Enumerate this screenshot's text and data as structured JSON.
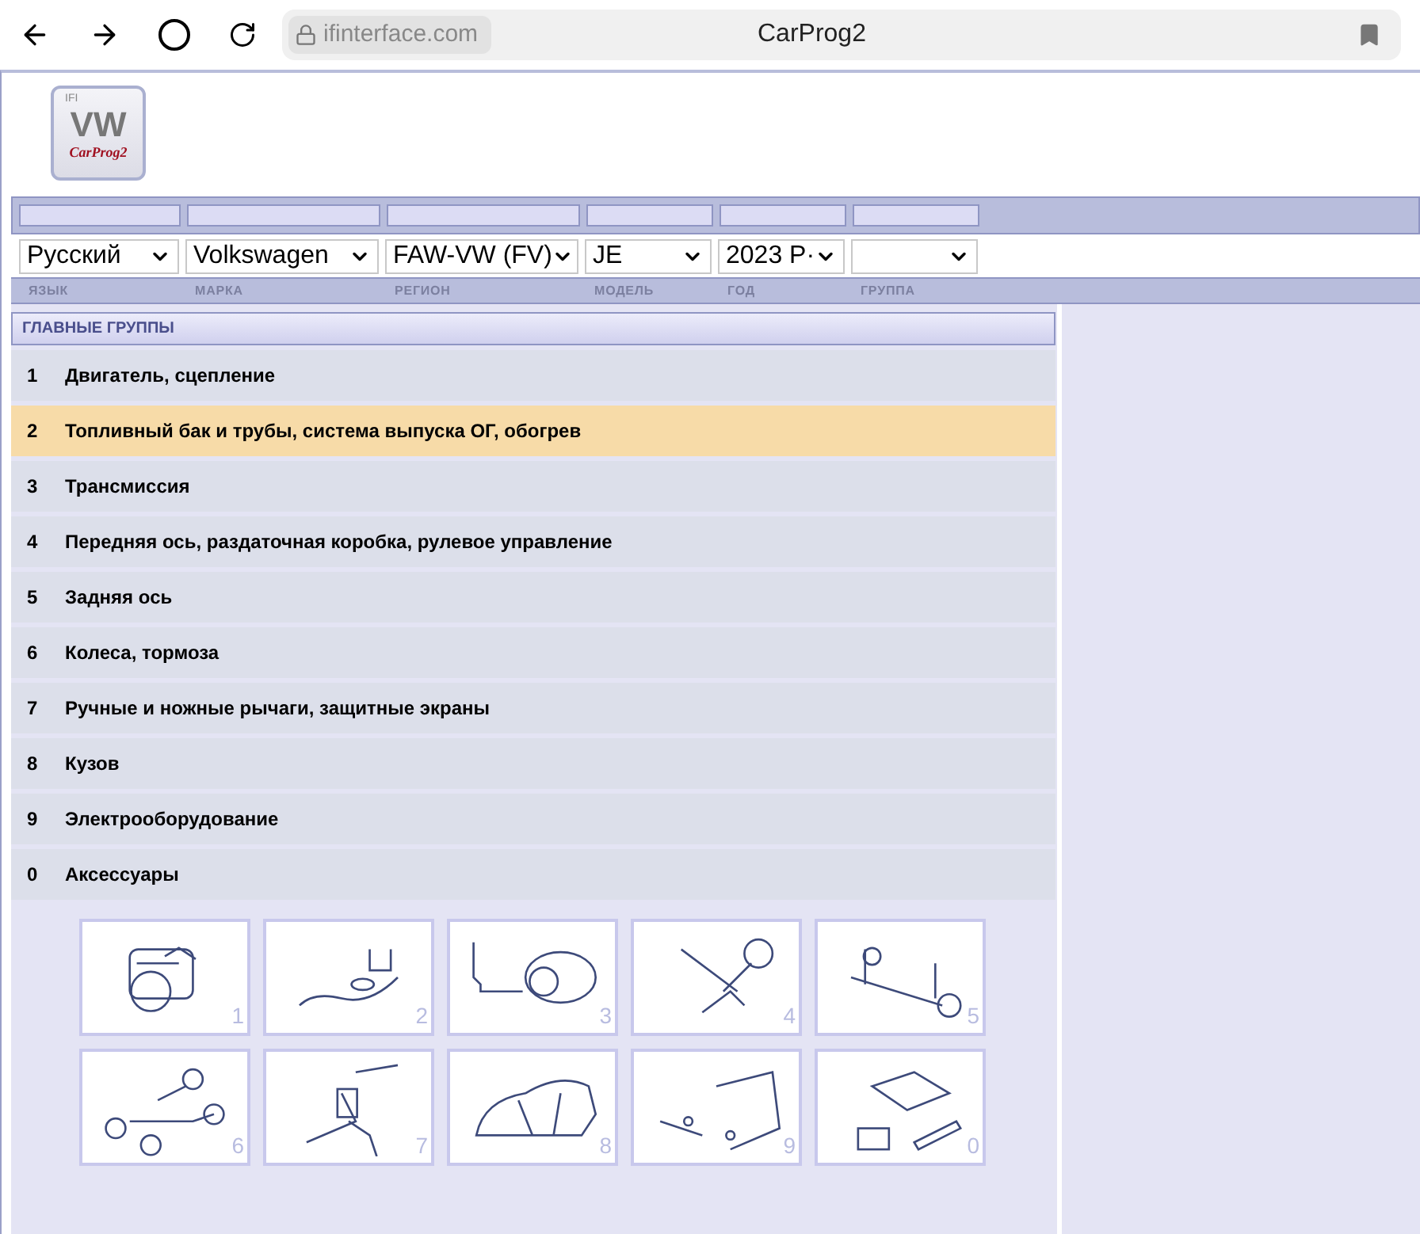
{
  "browser": {
    "address": "ifinterface.com",
    "title": "CarProg2"
  },
  "logo": {
    "corner": "IFI",
    "brand": "VW",
    "name": "CarProg2"
  },
  "filters": [
    {
      "label": "ЯЗЫК",
      "value": "Русский"
    },
    {
      "label": "МАРКА",
      "value": "Volkswagen"
    },
    {
      "label": "РЕГИОН",
      "value": "FAW-VW (FV)"
    },
    {
      "label": "МОДЕЛЬ",
      "value": "JE"
    },
    {
      "label": "ГОД",
      "value": "2023  P·"
    },
    {
      "label": "ГРУППА"
    }
  ],
  "groups": {
    "title": "ГЛАВНЫЕ ГРУППЫ",
    "items": [
      {
        "number": "1",
        "name": "Двигатель, сцепление",
        "selected": false
      },
      {
        "number": "2",
        "name": "Топливный бак и трубы, система выпуска ОГ, обогрев",
        "selected": true
      },
      {
        "number": "3",
        "name": "Трансмиссия",
        "selected": false
      },
      {
        "number": "4",
        "name": "Передняя ось, раздаточная коробка, рулевое управление",
        "selected": false
      },
      {
        "number": "5",
        "name": "Задняя ось",
        "selected": false
      },
      {
        "number": "6",
        "name": "Колеса, тормоза",
        "selected": false
      },
      {
        "number": "7",
        "name": "Ручные и ножные рычаги, защитные экраны",
        "selected": false
      },
      {
        "number": "8",
        "name": "Кузов",
        "selected": false
      },
      {
        "number": "9",
        "name": "Электрооборудование",
        "selected": false
      },
      {
        "number": "0",
        "name": "Аксессуары",
        "selected": false
      }
    ]
  },
  "thumbnails": [
    "1",
    "2",
    "3",
    "4",
    "5",
    "6",
    "7",
    "8",
    "9",
    "0"
  ]
}
